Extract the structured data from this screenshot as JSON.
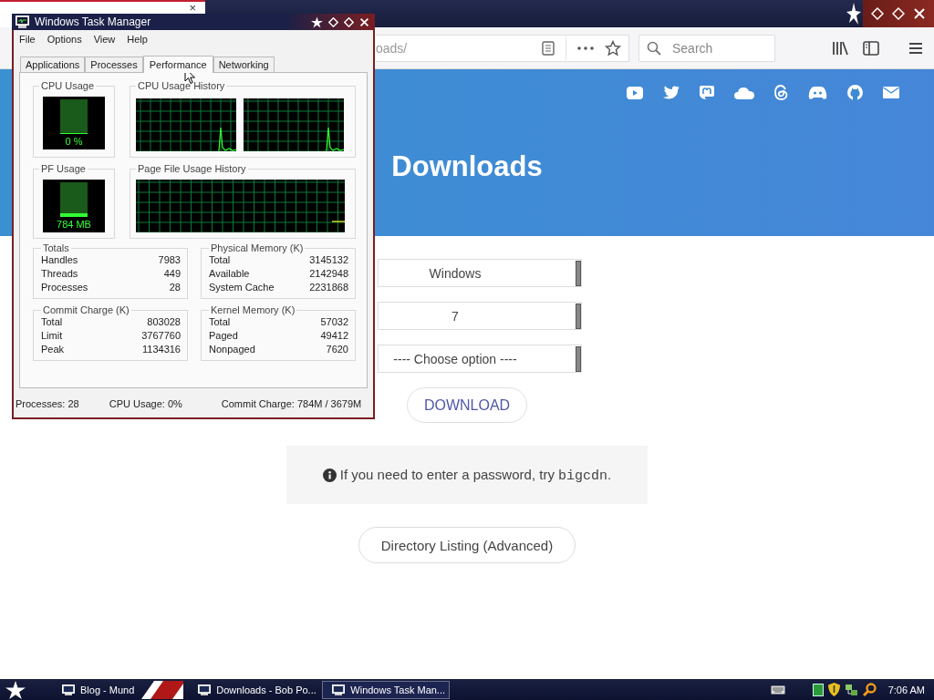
{
  "browser": {
    "tab_close": "×",
    "url": "oads/",
    "search": {
      "placeholder": "Search"
    },
    "page": {
      "title": "Downloads",
      "selects": [
        {
          "value": "Windows"
        },
        {
          "value": "7"
        },
        {
          "value": "---- Choose option ----"
        }
      ],
      "download_button": "DOWNLOAD",
      "notice": {
        "text": "If you need to enter a password, try",
        "code": "bigcdn",
        "end": "."
      },
      "directory_button": "Directory Listing (Advanced)"
    }
  },
  "task_manager": {
    "title": "Windows Task Manager",
    "menu": [
      "File",
      "Options",
      "View",
      "Help"
    ],
    "tabs": [
      {
        "label": "Applications",
        "selected": false
      },
      {
        "label": "Processes",
        "selected": false
      },
      {
        "label": "Performance",
        "selected": true
      },
      {
        "label": "Networking",
        "selected": false
      }
    ],
    "cpu_usage": {
      "label": "CPU Usage",
      "reading": "0 %",
      "level": 0
    },
    "cpu_history": {
      "label": "CPU Usage History"
    },
    "pf_usage": {
      "label": "PF Usage",
      "reading": "784 MB",
      "level": 0.1
    },
    "pf_history": {
      "label": "Page File Usage History"
    },
    "groups": [
      {
        "label": "Totals",
        "rows": [
          {
            "name": "Handles",
            "value": "7983"
          },
          {
            "name": "Threads",
            "value": "449"
          },
          {
            "name": "Processes",
            "value": "28"
          }
        ]
      },
      {
        "label": "Physical Memory (K)",
        "rows": [
          {
            "name": "Total",
            "value": "3145132"
          },
          {
            "name": "Available",
            "value": "2142948"
          },
          {
            "name": "System Cache",
            "value": "2231868"
          }
        ]
      },
      {
        "label": "Commit Charge (K)",
        "rows": [
          {
            "name": "Total",
            "value": "803028"
          },
          {
            "name": "Limit",
            "value": "3767760"
          },
          {
            "name": "Peak",
            "value": "1134316"
          }
        ]
      },
      {
        "label": "Kernel Memory (K)",
        "rows": [
          {
            "name": "Total",
            "value": "57032"
          },
          {
            "name": "Paged",
            "value": "49412"
          },
          {
            "name": "Nonpaged",
            "value": "7620"
          }
        ]
      }
    ],
    "status_bar": [
      "Processes: 28",
      "CPU Usage: 0%",
      "Commit Charge: 784M / 3679M"
    ]
  },
  "taskbar": {
    "items": [
      {
        "label": "Blog - Mund",
        "selected": false
      },
      {
        "label": "Downloads - Bob Po...",
        "selected": false
      },
      {
        "label": "Windows Task Man...",
        "selected": true
      }
    ],
    "clock": "7:06 AM"
  }
}
